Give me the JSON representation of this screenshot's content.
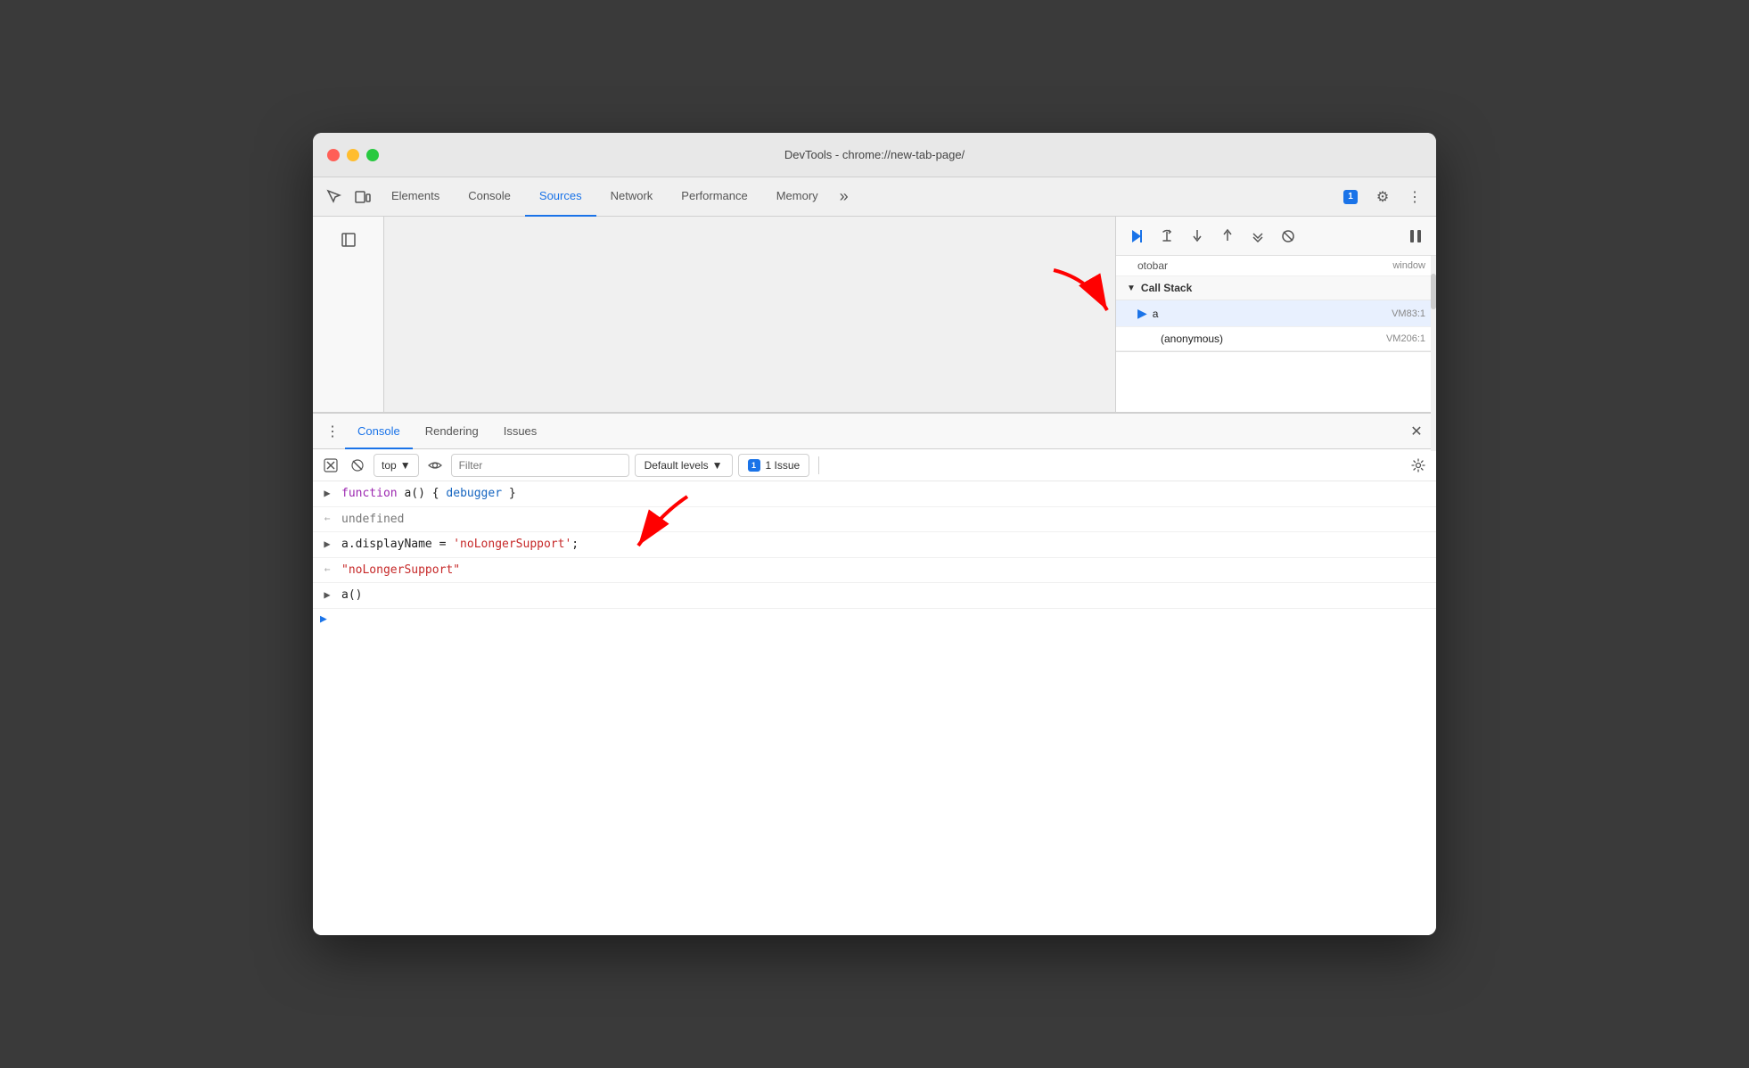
{
  "window": {
    "title": "DevTools - chrome://new-tab-page/"
  },
  "titlebar": {
    "close_label": "",
    "min_label": "",
    "max_label": ""
  },
  "tabs": {
    "items": [
      {
        "id": "elements",
        "label": "Elements",
        "active": false
      },
      {
        "id": "console",
        "label": "Console",
        "active": false
      },
      {
        "id": "sources",
        "label": "Sources",
        "active": true
      },
      {
        "id": "network",
        "label": "Network",
        "active": false
      },
      {
        "id": "performance",
        "label": "Performance",
        "active": false
      },
      {
        "id": "memory",
        "label": "Memory",
        "active": false
      }
    ],
    "more_label": "»",
    "badge_count": "1",
    "gear_label": "⚙",
    "overflow_label": "⋮"
  },
  "debug_toolbar": {
    "resume_label": "▶",
    "step_over_label": "↷",
    "step_into_label": "↓",
    "step_out_label": "↑",
    "step_label": "→",
    "deactivate_label": "⊘",
    "pause_label": "⏸"
  },
  "callstack": {
    "title": "Call Stack",
    "previous_row": {
      "label": "otobar",
      "location": "window"
    },
    "rows": [
      {
        "id": "row-a",
        "name": "a",
        "location": "VM83:1",
        "selected": true,
        "has_arrow": true
      },
      {
        "id": "row-anon",
        "name": "(anonymous)",
        "location": "VM206:1",
        "selected": false,
        "has_arrow": false
      }
    ]
  },
  "console_panel": {
    "tabs": [
      {
        "id": "console",
        "label": "Console",
        "active": true
      },
      {
        "id": "rendering",
        "label": "Rendering",
        "active": false
      },
      {
        "id": "issues",
        "label": "Issues",
        "active": false
      }
    ],
    "toolbar": {
      "clear_label": "🚫",
      "context": "top",
      "context_arrow": "▼",
      "eye_label": "👁",
      "filter_placeholder": "Filter",
      "default_levels": "Default levels",
      "default_levels_arrow": "▼",
      "issues_label": "1 Issue",
      "issues_count": "1"
    },
    "lines": [
      {
        "id": "line1",
        "type": "input-expand",
        "parts": [
          {
            "text": "function",
            "class": "kw-purple"
          },
          {
            "text": " a() { ",
            "class": "txt-dark"
          },
          {
            "text": "debugger",
            "class": "kw-blue"
          },
          {
            "text": " }",
            "class": "txt-dark"
          }
        ]
      },
      {
        "id": "line2",
        "type": "output",
        "parts": [
          {
            "text": "undefined",
            "class": "txt-gray"
          }
        ]
      },
      {
        "id": "line3",
        "type": "input-expand",
        "parts": [
          {
            "text": "a.displayName = ",
            "class": "txt-dark"
          },
          {
            "text": "'noLongerSupport'",
            "class": "str-red"
          },
          {
            "text": ";",
            "class": "txt-dark"
          }
        ],
        "has_red_arrow": true
      },
      {
        "id": "line4",
        "type": "output",
        "parts": [
          {
            "text": "\"noLongerSupport\"",
            "class": "str-red"
          }
        ]
      },
      {
        "id": "line5",
        "type": "input-expand",
        "parts": [
          {
            "text": "a()",
            "class": "txt-dark"
          }
        ]
      },
      {
        "id": "line6",
        "type": "cursor",
        "parts": []
      }
    ]
  },
  "annotations": {
    "red_arrow_1_label": "↙",
    "red_arrow_2_label": "↙"
  }
}
